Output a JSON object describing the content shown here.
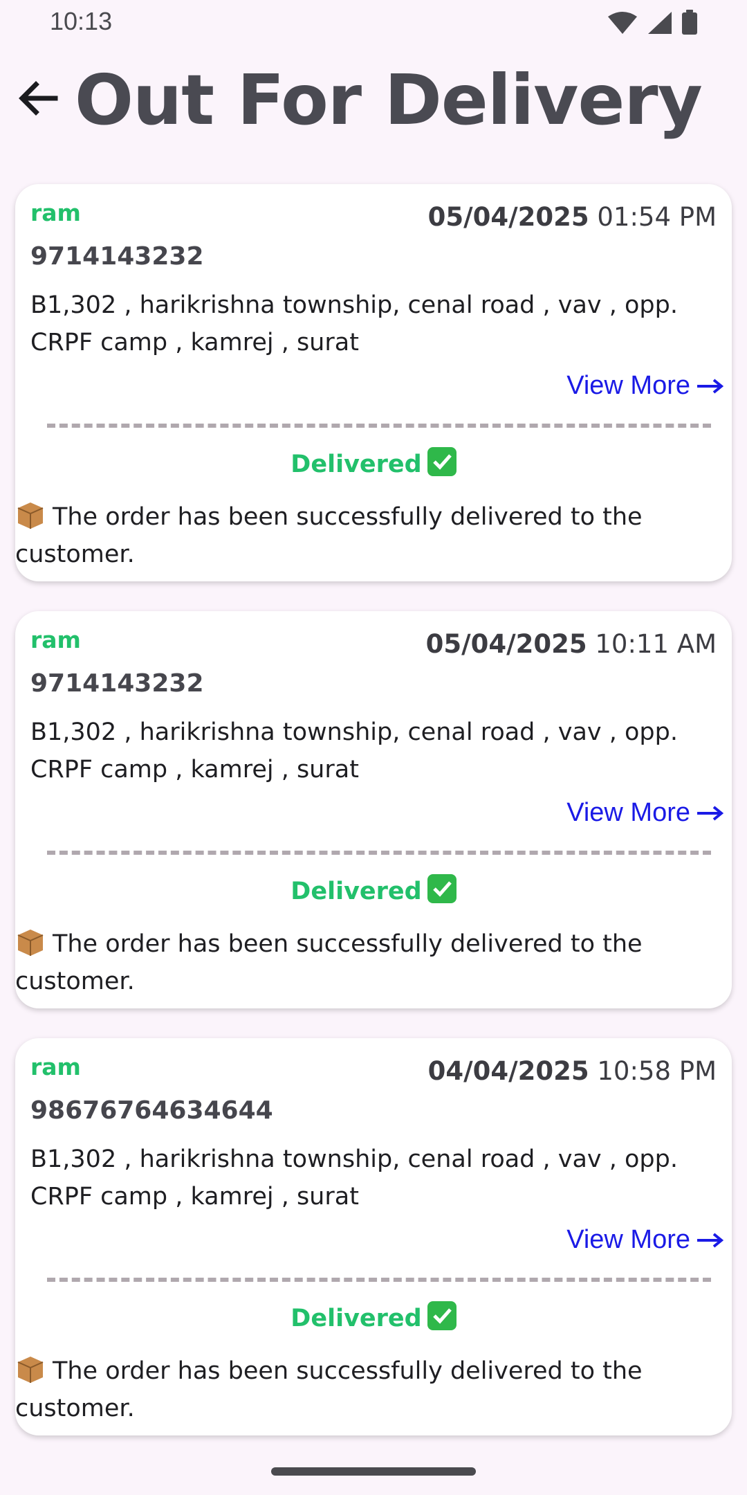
{
  "status_bar": {
    "time": "10:13",
    "icons": [
      "wifi-icon",
      "signal-icon",
      "battery-icon"
    ]
  },
  "header": {
    "title": "Out For Delivery",
    "back_icon": "back-arrow-icon"
  },
  "orders": [
    {
      "name": "ram",
      "date": "05/04/2025",
      "time": "01:54 PM",
      "phone": "9714143232",
      "address": "B1,302 , harikrishna township, cenal road , vav , opp. CRPF camp , kamrej , surat",
      "view_more_label": "View More",
      "status": "Delivered",
      "message": "The order has been successfully delivered to the customer."
    },
    {
      "name": "ram",
      "date": "05/04/2025",
      "time": "10:11 AM",
      "phone": "9714143232",
      "address": "B1,302 , harikrishna township, cenal road , vav , opp. CRPF camp , kamrej , surat",
      "view_more_label": "View More",
      "status": "Delivered",
      "message": "The order has been successfully delivered to the customer."
    },
    {
      "name": "ram",
      "date": "04/04/2025",
      "time": "10:58 PM",
      "phone": "98676764634644",
      "address": "B1,302 , harikrishna township, cenal road , vav , opp. CRPF camp , kamrej , surat",
      "view_more_label": "View More",
      "status": "Delivered",
      "message": "The order has been successfully delivered to the customer."
    }
  ],
  "colors": {
    "background": "#fbf4fb",
    "accent_green": "#22c06b",
    "link_blue": "#1a1ae6",
    "title": "#4a4a52"
  }
}
